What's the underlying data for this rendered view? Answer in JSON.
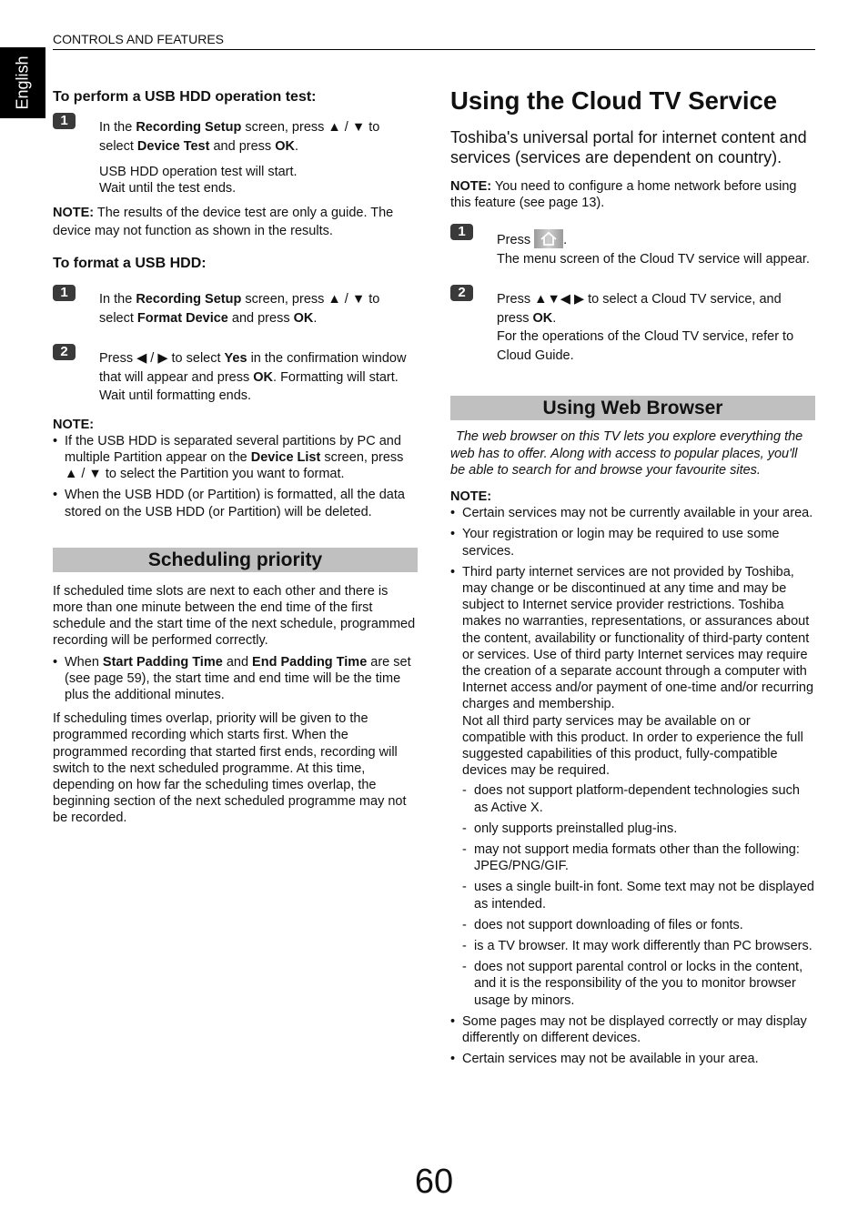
{
  "running_head": "CONTROLS AND FEATURES",
  "language_tab": "English",
  "left_column": {
    "usb_test": {
      "heading": "To perform a USB HDD operation test:",
      "step1": {
        "badge": "1",
        "t1": "In the ",
        "b1": "Recording Setup",
        "t2": " screen, press ▲ / ▼ to select ",
        "b2": "Device Test",
        "t3": " and press ",
        "b3": "OK",
        "t4": ".",
        "after_line1": "USB HDD operation test will start.",
        "after_line2": "Wait until the test ends."
      },
      "note_label": "NOTE:",
      "note_text": " The results of the device test are only a guide. The device may not function as shown in the results."
    },
    "format": {
      "heading": "To format a USB HDD:",
      "step1": {
        "badge": "1",
        "t1": "In the ",
        "b1": "Recording Setup",
        "t2": " screen, press ▲ / ▼ to select ",
        "b2": "Format Device",
        "t3": " and press ",
        "b3": "OK",
        "t4": "."
      },
      "step2": {
        "badge": "2",
        "t1": "Press ◀ / ▶ to select ",
        "b1": "Yes",
        "t2": " in the confirmation window that will appear and press ",
        "b2": "OK",
        "t3": ". Formatting will start.",
        "line2": "Wait until formatting ends."
      },
      "note_label": "NOTE:",
      "notes": [
        {
          "t1": "If the USB HDD is separated several partitions by PC and multiple Partition appear on the ",
          "b1": "Device List",
          "t2": " screen, press ▲ / ▼ to select the Partition you want to format."
        },
        {
          "t1": "When the USB HDD (or Partition) is formatted, all the data stored on the USB HDD (or Partition) will be deleted."
        }
      ]
    },
    "scheduling": {
      "title": "Scheduling priority",
      "para1": "If scheduled time slots are next to each other and there is more than one minute between the end time of the first schedule and the start time of the next schedule, programmed recording will be performed correctly.",
      "bullet": {
        "t1": "When ",
        "b1": "Start Padding Time",
        "t2": " and ",
        "b2": "End Padding Time",
        "t3": " are set (see page 59), the start time and end time will be the time plus the additional minutes."
      },
      "para2": "If scheduling times overlap, priority will be given to the programmed recording which starts first. When the programmed recording that started first ends, recording will switch to the next scheduled programme. At this time, depending on how far the scheduling times overlap, the beginning section of the next scheduled programme may not be recorded."
    }
  },
  "right_column": {
    "cloud": {
      "title": "Using the Cloud TV Service",
      "lead": "Toshiba's universal portal for internet content and services (services are dependent on country).",
      "note_label": "NOTE:",
      "note_text": " You need to configure a home network before using this feature (see page 13).",
      "step1": {
        "badge": "1",
        "press": "Press ",
        "icon": "home-icon",
        "period": ".",
        "line2": "The menu screen of the Cloud TV service will appear."
      },
      "step2": {
        "badge": "2",
        "t1": "Press ▲▼◀ ▶ to select a Cloud TV service, and press ",
        "b1": "OK",
        "t2": ".",
        "line2": "For the operations of the Cloud TV service, refer to Cloud Guide."
      }
    },
    "web": {
      "title": "Using Web Browser",
      "intro": "The web browser on this TV lets you explore everything the web has to offer. Along with access to popular places, you'll be able to search for and browse your favourite sites.",
      "note_label": "NOTE:",
      "bullet1": "Certain services may not be currently available in your area.",
      "bullet2": "Your registration or login may be required to use some services.",
      "bullet3_p1": "Third party internet services are not provided by Toshiba, may change or be discontinued at any time and may be subject to Internet service provider restrictions. Toshiba makes no warranties, representations, or assurances about the content, availability or functionality of third-party content or services. Use of third party Internet services may require the creation of a separate account through a computer with Internet access and/or payment of one-time and/or recurring charges and membership.",
      "bullet3_p2": "Not all third party services may be available on or compatible with this product. In order to experience the full suggested capabilities of this product, fully-compatible devices may be required.",
      "dashes": [
        "does not support platform-dependent technologies such as Active X.",
        "only supports preinstalled plug-ins.",
        "may not support media formats other than the following: JPEG/PNG/GIF.",
        "uses a single built-in font. Some text may not be displayed as intended.",
        "does not support downloading of files or fonts.",
        "is a TV browser. It may work differently than PC browsers.",
        "does not support parental control or locks in the content, and it is the responsibility of the you to monitor browser usage by minors."
      ],
      "bullet4": "Some pages may not be displayed correctly or may display differently on different devices.",
      "bullet5": "Certain services may not be available in your area."
    }
  },
  "page_number": "60"
}
